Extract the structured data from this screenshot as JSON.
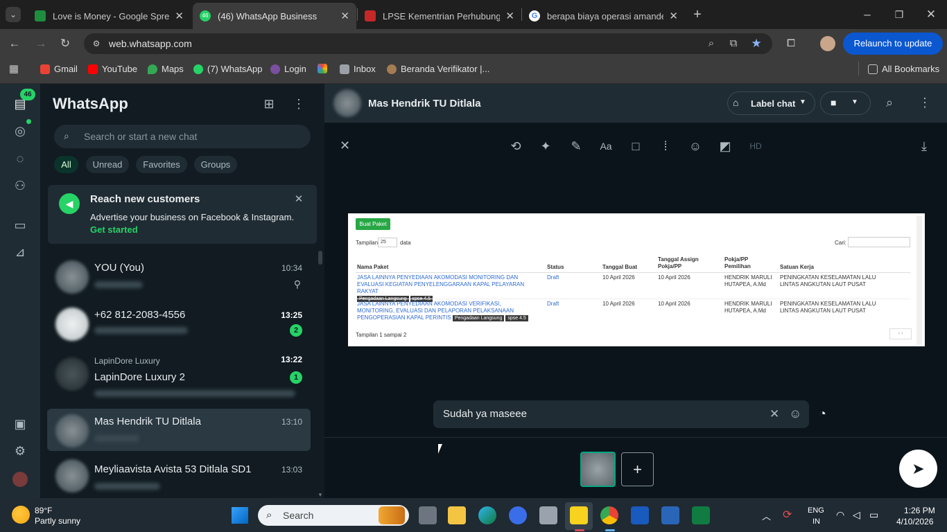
{
  "browser": {
    "tabs": [
      {
        "title": "Love is Money - Google Spread",
        "color": "#1e8e3e"
      },
      {
        "title": "(46) WhatsApp Business",
        "color": "#25d366",
        "active": true
      },
      {
        "title": "LPSE Kementrian Perhubungan",
        "color": "#c62828"
      },
      {
        "title": "berapa biaya operasi amandel -",
        "color": "#ffffff"
      }
    ],
    "url": "web.whatsapp.com",
    "relaunch_label": "Relaunch to update",
    "bookmarks": [
      "Gmail",
      "YouTube",
      "Maps",
      "(7) WhatsApp",
      "Login",
      "",
      "Inbox",
      "Beranda Verifikator |..."
    ],
    "all_bookmarks": "All Bookmarks"
  },
  "wa": {
    "rail_badge": "46",
    "title": "WhatsApp",
    "search_placeholder": "Search or start a new chat",
    "filters": [
      "All",
      "Unread",
      "Favorites",
      "Groups"
    ],
    "promo": {
      "title": "Reach new customers",
      "body": "Advertise your business on Facebook & Instagram.",
      "cta": "Get started"
    },
    "chats": [
      {
        "name": "YOU (You)",
        "time": "10:34",
        "pinned": true
      },
      {
        "name": "+62 812-2083-4556",
        "time": "13:25",
        "badge": "2"
      },
      {
        "label": "LapinDore Luxury",
        "name": "LapinDore Luxury 2",
        "time": "13:22",
        "badge": "1"
      },
      {
        "name": "Mas Hendrik TU Ditlala",
        "time": "13:10"
      },
      {
        "name": "Meyliaavista Avista 53 Ditlala SD1",
        "time": "13:03"
      }
    ],
    "header": {
      "name": "Mas Hendrik TU Ditlala",
      "label_chat": "Label chat"
    },
    "caption": "Sudah ya maseee"
  },
  "preview": {
    "button": "Buat Paket",
    "tampilan": "Tampilan",
    "page_size": "25",
    "data_label": "data",
    "cari": "Cari:",
    "columns": [
      "Nama Paket",
      "Status",
      "Tanggal Buat",
      "Tanggal Assign Pokja/PP",
      "Pokja/PP Pemilihan",
      "Satuan Kerja"
    ],
    "rows": [
      {
        "nama": "JASA LAINNYA PENYEDIAAN AKOMODASI MONITORING DAN EVALUASI KEGIATAN PENYELENGGARAAN KAPAL PELAYARAN RAKYAT",
        "tags": [
          "Pengadaan Langsung",
          "spse 4.5"
        ],
        "status": "Draft",
        "tgl_buat": "10 April 2026",
        "tgl_assign": "10 April 2026",
        "pokja": "HENDRIK MARULI HUTAPEA, A.Md",
        "satker": "PENINGKATAN KESELAMATAN LALU LINTAS ANGKUTAN LAUT PUSAT"
      },
      {
        "nama": "JASA LAINNYA PENYEDIAAN AKOMODASI VERIFIKASI, MONITORING, EVALUASI DAN PELAPORAN PELAKSANAAN PENGOPERASIAN KAPAL PERINTIS",
        "tags": [
          "Pengadaan Langsung",
          "spse 4.5"
        ],
        "status": "Draft",
        "tgl_buat": "10 April 2026",
        "tgl_assign": "10 April 2026",
        "pokja": "HENDRIK MARULI HUTAPEA, A.Md",
        "satker": "PENINGKATAN KESELAMATAN LALU LINTAS ANGKUTAN LAUT PUSAT"
      }
    ],
    "footer": "Tampilan 1 sampai 2"
  },
  "taskbar": {
    "weather_temp": "89°F",
    "weather_desc": "Partly sunny",
    "search": "Search",
    "lang1": "ENG",
    "lang2": "IN",
    "time": "1:26 PM",
    "date": "4/10/2026"
  }
}
